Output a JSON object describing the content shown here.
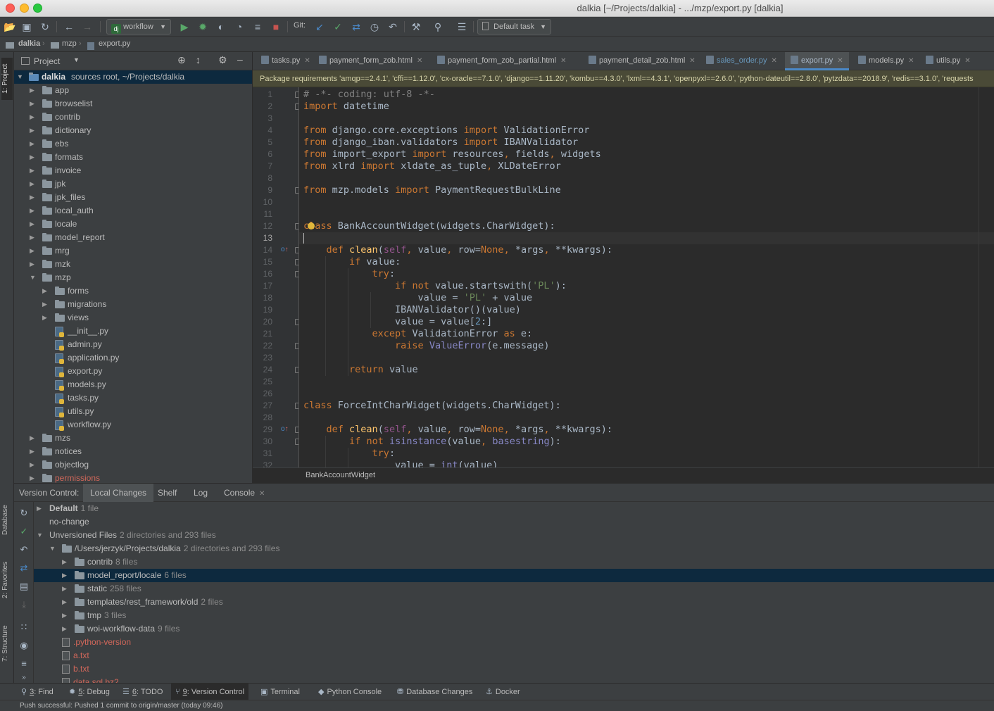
{
  "window": {
    "title": "dalkia [~/Projects/dalkia] - .../mzp/export.py [dalkia]"
  },
  "toolbar": {
    "run_config": "workflow",
    "git_label": "Git:",
    "task_label": "Default task"
  },
  "breadcrumb": [
    "dalkia",
    "mzp",
    "export.py"
  ],
  "left_stripe": {
    "project": "1: Project",
    "database": "Database",
    "favorites": "2: Favorites",
    "structure": "7: Structure"
  },
  "project": {
    "header": "Project",
    "root_name": "dalkia",
    "root_detail": "sources root, ~/Projects/dalkia",
    "items": [
      {
        "label": "app",
        "depth": 1,
        "kind": "folder",
        "expanded": false
      },
      {
        "label": "browselist",
        "depth": 1,
        "kind": "folder",
        "expanded": false
      },
      {
        "label": "contrib",
        "depth": 1,
        "kind": "folder",
        "expanded": false
      },
      {
        "label": "dictionary",
        "depth": 1,
        "kind": "folder",
        "expanded": false
      },
      {
        "label": "ebs",
        "depth": 1,
        "kind": "folder",
        "expanded": false
      },
      {
        "label": "formats",
        "depth": 1,
        "kind": "folder",
        "expanded": false
      },
      {
        "label": "invoice",
        "depth": 1,
        "kind": "folder",
        "expanded": false
      },
      {
        "label": "jpk",
        "depth": 1,
        "kind": "folder",
        "expanded": false
      },
      {
        "label": "jpk_files",
        "depth": 1,
        "kind": "folder",
        "expanded": false
      },
      {
        "label": "local_auth",
        "depth": 1,
        "kind": "folder",
        "expanded": false
      },
      {
        "label": "locale",
        "depth": 1,
        "kind": "folder",
        "expanded": false
      },
      {
        "label": "model_report",
        "depth": 1,
        "kind": "folder",
        "expanded": false
      },
      {
        "label": "mrg",
        "depth": 1,
        "kind": "folder",
        "expanded": false
      },
      {
        "label": "mzk",
        "depth": 1,
        "kind": "folder",
        "expanded": false
      },
      {
        "label": "mzp",
        "depth": 1,
        "kind": "folder",
        "expanded": true
      },
      {
        "label": "forms",
        "depth": 2,
        "kind": "folder",
        "expanded": false
      },
      {
        "label": "migrations",
        "depth": 2,
        "kind": "folder",
        "expanded": false
      },
      {
        "label": "views",
        "depth": 2,
        "kind": "folder",
        "expanded": false
      },
      {
        "label": "__init__.py",
        "depth": 2,
        "kind": "py"
      },
      {
        "label": "admin.py",
        "depth": 2,
        "kind": "py"
      },
      {
        "label": "application.py",
        "depth": 2,
        "kind": "py"
      },
      {
        "label": "export.py",
        "depth": 2,
        "kind": "py"
      },
      {
        "label": "models.py",
        "depth": 2,
        "kind": "py"
      },
      {
        "label": "tasks.py",
        "depth": 2,
        "kind": "py"
      },
      {
        "label": "utils.py",
        "depth": 2,
        "kind": "py"
      },
      {
        "label": "workflow.py",
        "depth": 2,
        "kind": "py"
      },
      {
        "label": "mzs",
        "depth": 1,
        "kind": "folder",
        "expanded": false
      },
      {
        "label": "notices",
        "depth": 1,
        "kind": "folder",
        "expanded": false
      },
      {
        "label": "objectlog",
        "depth": 1,
        "kind": "folder",
        "expanded": false
      },
      {
        "label": "permissions",
        "depth": 1,
        "kind": "folder",
        "expanded": false,
        "status": "unversioned"
      }
    ]
  },
  "tabs": [
    {
      "label": "tasks.py",
      "active": false
    },
    {
      "label": "payment_form_zob.html",
      "active": false
    },
    {
      "label": "payment_form_zob_partial.html",
      "active": false
    },
    {
      "label": "payment_detail_zob.html",
      "active": false
    },
    {
      "label": "sales_order.py",
      "active": false,
      "color": "#6897bb"
    },
    {
      "label": "export.py",
      "active": true
    },
    {
      "label": "models.py",
      "active": false
    },
    {
      "label": "utils.py",
      "active": false
    }
  ],
  "banner": "Package requirements 'amqp==2.4.1', 'cffi==1.12.0', 'cx-oracle==7.1.0', 'django==1.11.20', 'kombu==4.3.0', 'lxml==4.3.1', 'openpyxl==2.6.0', 'python-dateutil==2.8.0', 'pytzdata==2018.9', 'redis==3.1.0', 'requests",
  "code_lines": [
    "# -*- coding: utf-8 -*-",
    "import datetime",
    "",
    "from django.core.exceptions import ValidationError",
    "from django_iban.validators import IBANValidator",
    "from import_export import resources, fields, widgets",
    "from xlrd import xldate_as_tuple, XLDateError",
    "",
    "from mzp.models import PaymentRequestBulkLine",
    "",
    "",
    "class BankAccountWidget(widgets.CharWidget):",
    "",
    "    def clean(self, value, row=None, *args, **kwargs):",
    "        if value:",
    "            try:",
    "                if not value.startswith('PL'):",
    "                    value = 'PL' + value",
    "                IBANValidator()(value)",
    "                value = value[2:]",
    "            except ValidationError as e:",
    "                raise ValueError(e.message)",
    "",
    "        return value",
    "",
    "",
    "class ForceIntCharWidget(widgets.CharWidget):",
    "",
    "    def clean(self, value, row=None, *args, **kwargs):",
    "        if not isinstance(value, basestring):",
    "            try:",
    "                value = int(value)"
  ],
  "editor_breadcrumb": "BankAccountWidget",
  "vcs": {
    "title": "Version Control:",
    "tabs": [
      "Local Changes",
      "Shelf",
      "Log",
      "Console"
    ],
    "rows": [
      {
        "label": "Default",
        "count": "1 file",
        "depth": 0,
        "arrow": "right",
        "bold": true
      },
      {
        "label": "no-change",
        "count": "",
        "depth": 0,
        "arrow": "none"
      },
      {
        "label": "Unversioned Files",
        "count": "2 directories and 293 files",
        "depth": 0,
        "arrow": "down"
      },
      {
        "label": "/Users/jerzyk/Projects/dalkia",
        "count": "2 directories and 293 files",
        "depth": 1,
        "arrow": "down",
        "kind": "folder"
      },
      {
        "label": "contrib",
        "count": "8 files",
        "depth": 2,
        "arrow": "right",
        "kind": "folder"
      },
      {
        "label": "model_report/locale",
        "count": "6 files",
        "depth": 2,
        "arrow": "right",
        "kind": "folder",
        "selected": true
      },
      {
        "label": "static",
        "count": "258 files",
        "depth": 2,
        "arrow": "right",
        "kind": "folder"
      },
      {
        "label": "templates/rest_framework/old",
        "count": "2 files",
        "depth": 2,
        "arrow": "right",
        "kind": "folder"
      },
      {
        "label": "tmp",
        "count": "3 files",
        "depth": 2,
        "arrow": "right",
        "kind": "folder"
      },
      {
        "label": "woi-workflow-data",
        "count": "9 files",
        "depth": 2,
        "arrow": "right",
        "kind": "folder"
      },
      {
        "label": ".python-version",
        "count": "",
        "depth": 2,
        "arrow": "none",
        "kind": "file",
        "unversioned": true
      },
      {
        "label": "a.txt",
        "count": "",
        "depth": 2,
        "arrow": "none",
        "kind": "file",
        "unversioned": true
      },
      {
        "label": "b.txt",
        "count": "",
        "depth": 2,
        "arrow": "none",
        "kind": "file",
        "unversioned": true
      },
      {
        "label": "data.sql.bz2",
        "count": "",
        "depth": 2,
        "arrow": "none",
        "kind": "file",
        "unversioned": true
      }
    ]
  },
  "bottom_tools": [
    {
      "num": "3",
      "label": ": Find"
    },
    {
      "num": "5",
      "label": ": Debug"
    },
    {
      "num": "6",
      "label": ": TODO"
    },
    {
      "num": "9",
      "label": ": Version Control",
      "active": true
    },
    {
      "num": "",
      "label": "Terminal"
    },
    {
      "num": "",
      "label": "Python Console"
    },
    {
      "num": "",
      "label": "Database Changes"
    },
    {
      "num": "",
      "label": "Docker"
    }
  ],
  "status": "Push successful: Pushed 1 commit to origin/master (today 09:46)",
  "colors": {
    "background": "#2b2b2b",
    "panel": "#3c3f41",
    "keyword": "#cc7832",
    "string": "#6a8759",
    "accent": "#4a88c7",
    "selection": "#0d293e",
    "unversioned": "#d1675a"
  }
}
